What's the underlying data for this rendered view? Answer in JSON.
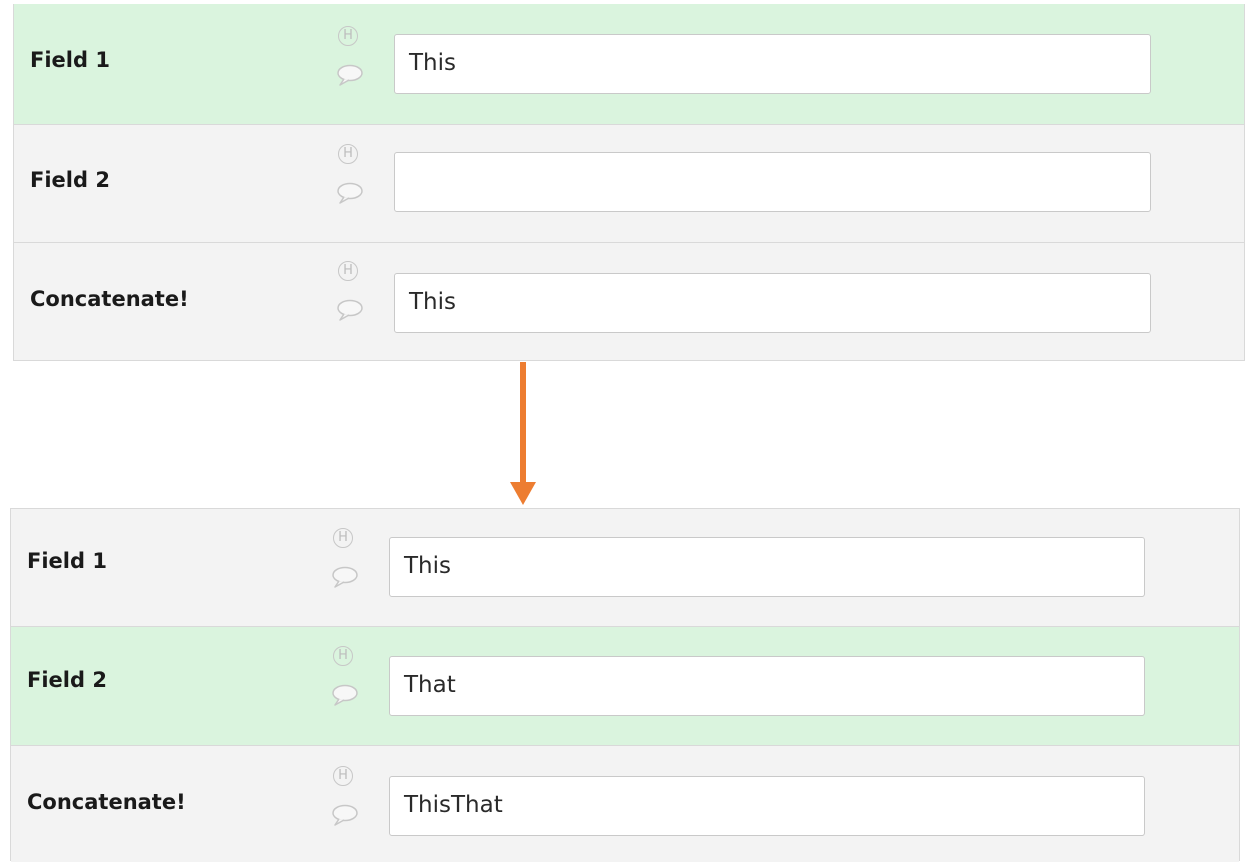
{
  "before": {
    "rows": [
      {
        "label": "Field 1",
        "value": "This",
        "highlighted": true
      },
      {
        "label": "Field 2",
        "value": "",
        "highlighted": false
      },
      {
        "label": "Concatenate!",
        "value": "This",
        "highlighted": false
      }
    ]
  },
  "after": {
    "rows": [
      {
        "label": "Field 1",
        "value": "This",
        "highlighted": false
      },
      {
        "label": "Field 2",
        "value": "That",
        "highlighted": true
      },
      {
        "label": "Concatenate!",
        "value": "ThisThat",
        "highlighted": false
      }
    ]
  },
  "icons": {
    "history": {
      "name": "history-icon",
      "glyph": "H"
    },
    "comment": {
      "name": "comment-bubble-icon"
    }
  },
  "colors": {
    "highlight_row": "#daf4de",
    "row_bg": "#f3f3f3",
    "arrow": "#ed7d31"
  }
}
